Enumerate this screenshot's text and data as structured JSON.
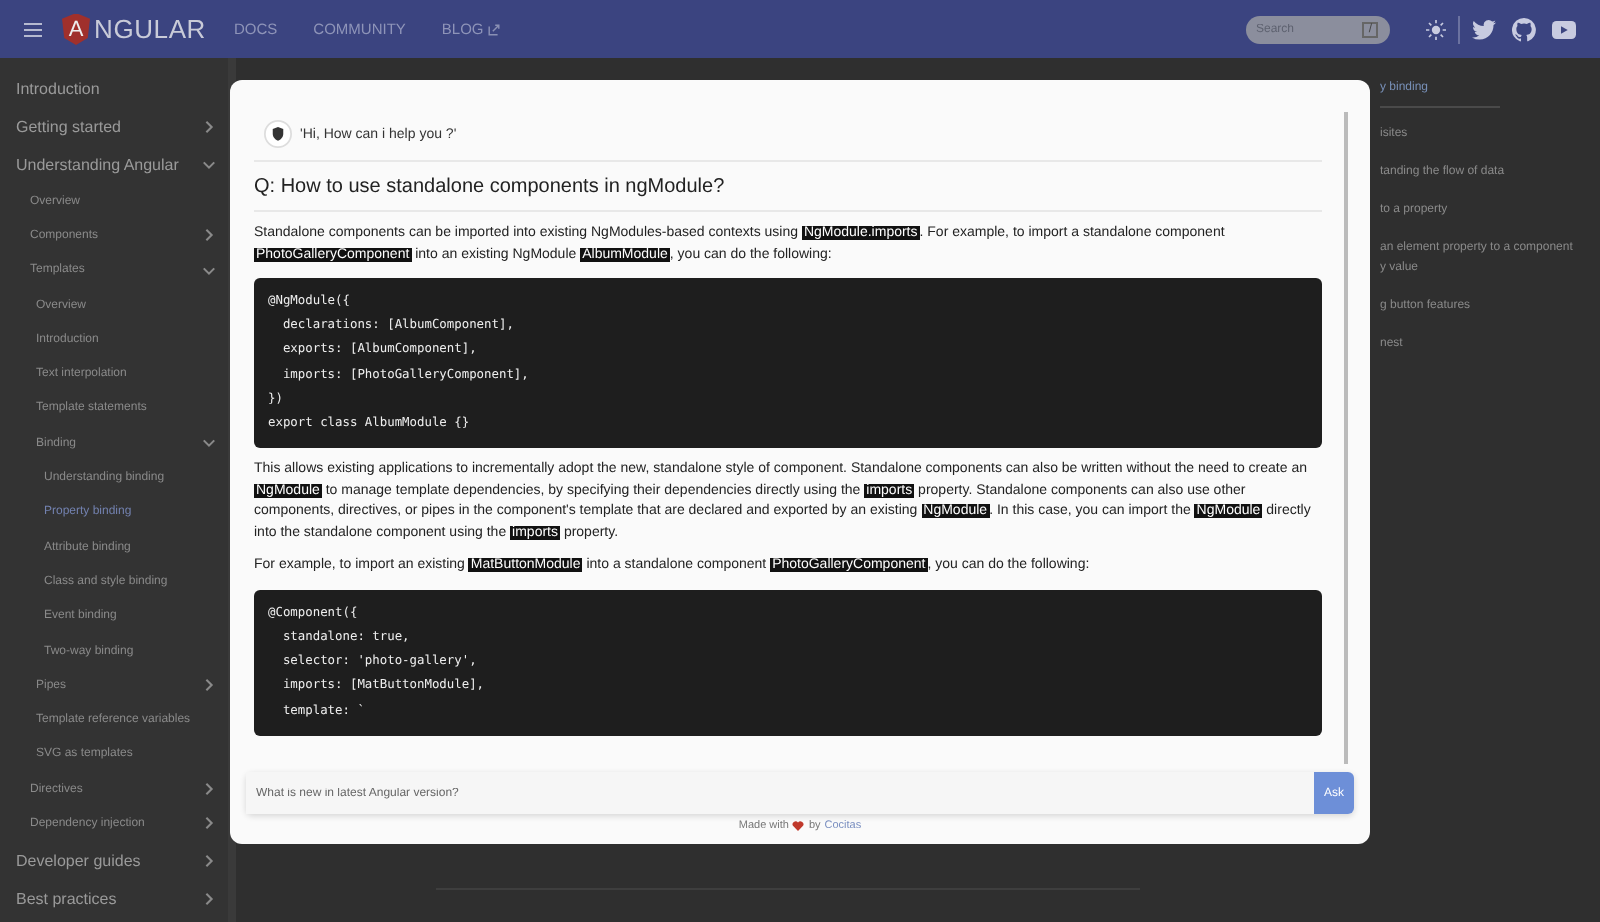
{
  "header": {
    "logo_letter": "A",
    "logo_text": "NGULAR",
    "nav": [
      {
        "label": "DOCS",
        "external": false
      },
      {
        "label": "COMMUNITY",
        "external": false
      },
      {
        "label": "BLOG",
        "external": true
      }
    ],
    "search": {
      "placeholder": "Search",
      "shortcut": "/"
    }
  },
  "sidebar": {
    "items": [
      {
        "label": "Introduction",
        "selected": false
      },
      {
        "label": "Getting started",
        "selected": false,
        "expanded": false
      },
      {
        "label": "Understanding Angular",
        "selected": false,
        "expanded": true,
        "children": [
          {
            "label": "Overview",
            "selected": false
          },
          {
            "label": "Components",
            "selected": false,
            "expanded": false
          },
          {
            "label": "Templates",
            "selected": false,
            "expanded": true,
            "children": [
              {
                "label": "Overview",
                "selected": false
              },
              {
                "label": "Introduction",
                "selected": false
              },
              {
                "label": "Text interpolation",
                "selected": false
              },
              {
                "label": "Template statements",
                "selected": false
              },
              {
                "label": "Binding",
                "selected": false,
                "expanded": true,
                "children": [
                  {
                    "label": "Understanding binding",
                    "selected": false
                  },
                  {
                    "label": "Property binding",
                    "selected": true
                  },
                  {
                    "label": "Attribute binding",
                    "selected": false
                  },
                  {
                    "label": "Class and style binding",
                    "selected": false
                  },
                  {
                    "label": "Event binding",
                    "selected": false
                  },
                  {
                    "label": "Two-way binding",
                    "selected": false
                  }
                ]
              },
              {
                "label": "Pipes",
                "selected": false,
                "expanded": false
              },
              {
                "label": "Template reference variables",
                "selected": false
              },
              {
                "label": "SVG as templates",
                "selected": false
              }
            ]
          },
          {
            "label": "Directives",
            "selected": false,
            "expanded": false
          },
          {
            "label": "Dependency injection",
            "selected": false,
            "expanded": false
          }
        ]
      },
      {
        "label": "Developer guides",
        "selected": false,
        "expanded": false
      },
      {
        "label": "Best practices",
        "selected": false,
        "expanded": false
      }
    ]
  },
  "toc": {
    "items": [
      {
        "label": "y binding",
        "selected": true
      },
      {
        "label": "isites",
        "selected": false
      },
      {
        "label": "tanding the flow of data",
        "selected": false
      },
      {
        "label": "to a property",
        "selected": false
      },
      {
        "label": "an element property to a component\ny value",
        "selected": false
      },
      {
        "label": "g button features",
        "selected": false
      },
      {
        "label": "nest",
        "selected": false
      }
    ]
  },
  "chat": {
    "greeting": "'Hi, How can i help you ?'",
    "question": "Q: How to use standalone components in ngModule?",
    "blocks": [
      {
        "kind": "paragraph",
        "segments": [
          {
            "text": "Standalone components can be imported into existing NgModules-based contexts using ",
            "code": false
          },
          {
            "text": "NgModule.imports",
            "code": true
          },
          {
            "text": ". For example, to import a standalone component ",
            "code": false
          },
          {
            "text": "PhotoGalleryComponent",
            "code": true
          },
          {
            "text": " into an existing NgModule ",
            "code": false
          },
          {
            "text": "AlbumModule",
            "code": true
          },
          {
            "text": ", you can do the following:",
            "code": false
          }
        ]
      },
      {
        "kind": "code",
        "lines": [
          "@NgModule({",
          "  declarations: [AlbumComponent],",
          "  exports: [AlbumComponent],",
          "  imports: [PhotoGalleryComponent],",
          "})",
          "export class AlbumModule {}"
        ]
      },
      {
        "kind": "paragraph",
        "segments": [
          {
            "text": "This allows existing applications to incrementally adopt the new, standalone style of component. Standalone components can also be written without the need to create an ",
            "code": false
          },
          {
            "text": "NgModule",
            "code": true
          },
          {
            "text": " to manage template dependencies, by specifying their dependencies directly using the ",
            "code": false
          },
          {
            "text": "imports",
            "code": true
          },
          {
            "text": " property. Standalone components can also use other components, directives, or pipes in the component's template that are declared and exported by an existing ",
            "code": false
          },
          {
            "text": "NgModule",
            "code": true
          },
          {
            "text": ". In this case, you can import the ",
            "code": false
          },
          {
            "text": "NgModule",
            "code": true
          },
          {
            "text": " directly into the standalone component using the ",
            "code": false
          },
          {
            "text": "imports",
            "code": true
          },
          {
            "text": " property.",
            "code": false
          }
        ]
      },
      {
        "kind": "paragraph",
        "segments": [
          {
            "text": "For example, to import an existing ",
            "code": false
          },
          {
            "text": "MatButtonModule",
            "code": true
          },
          {
            "text": " into a standalone component ",
            "code": false
          },
          {
            "text": "PhotoGalleryComponent",
            "code": true
          },
          {
            "text": ", you can do the following:",
            "code": false
          }
        ]
      },
      {
        "kind": "code",
        "lines": [
          "@Component({",
          "  standalone: true,",
          "  selector: 'photo-gallery',",
          "  imports: [MatButtonModule],",
          "  template: `"
        ]
      }
    ],
    "input": {
      "placeholder": "What is new in latest Angular version?"
    },
    "ask_button": "Ask",
    "footer": {
      "prefix": "Made with",
      "by": "by",
      "link": "Cocitas"
    }
  }
}
